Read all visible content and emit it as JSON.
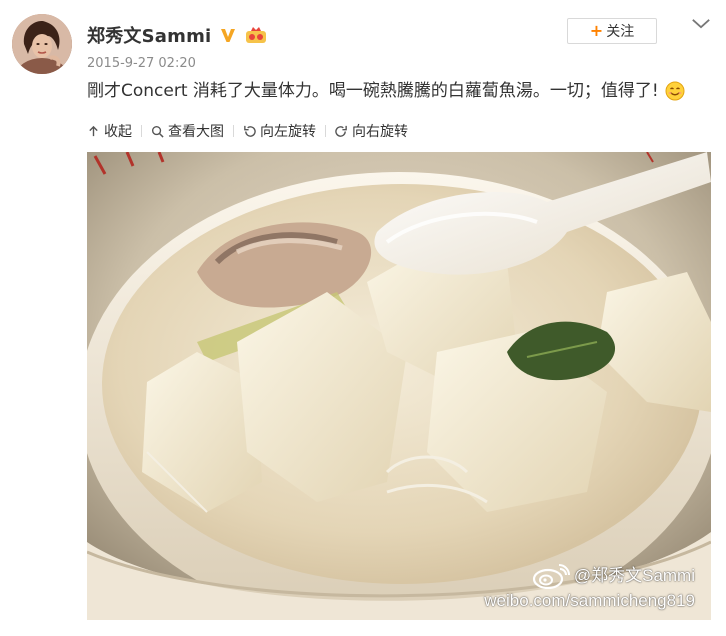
{
  "post": {
    "username": "郑秀文Sammi",
    "timestamp": "2015-9-27 02:20",
    "text": "剛才Concert 消耗了大量体力。喝一碗熱騰騰的白蘿蔔魚湯。一切；值得了!",
    "follow_label": "关注"
  },
  "toolbar": {
    "items": [
      {
        "label": "收起",
        "icon": "collapse-icon"
      },
      {
        "label": "查看大图",
        "icon": "magnify-icon"
      },
      {
        "label": "向左旋转",
        "icon": "rotate-left-icon"
      },
      {
        "label": "向右旋转",
        "icon": "rotate-right-icon"
      }
    ]
  },
  "photo": {
    "watermark_user": "@郑秀文Sammi",
    "watermark_url": "weibo.com/sammicheng819"
  },
  "colors": {
    "accent": "#ff8200",
    "verified": "#f5a623",
    "text": "#333333",
    "muted": "#8b8b8b"
  }
}
